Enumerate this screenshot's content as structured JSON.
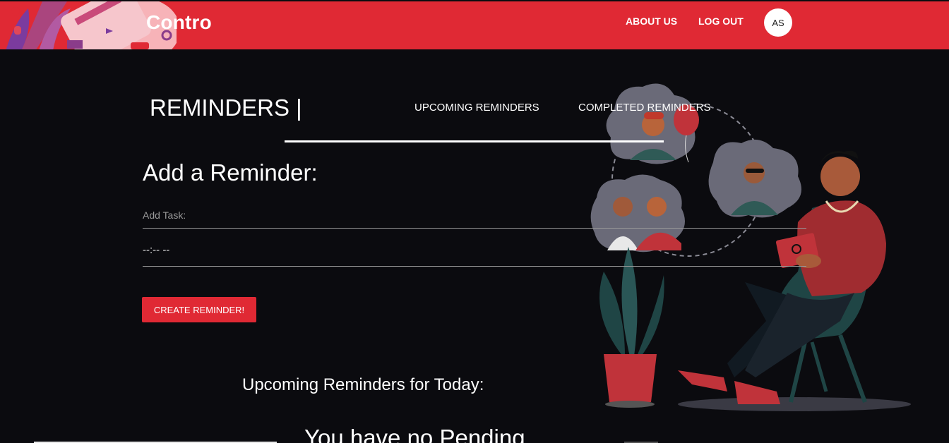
{
  "navbar": {
    "brand": "Contro",
    "links": [
      {
        "label": "ABOUT US"
      },
      {
        "label": "LOG OUT"
      }
    ],
    "avatar_initials": "AS",
    "accent_color": "#e02934"
  },
  "header": {
    "title": "REMINDERS |",
    "tabs": [
      {
        "label": "UPCOMING REMINDERS"
      },
      {
        "label": "COMPLETED REMINDERS"
      }
    ]
  },
  "form": {
    "heading": "Add a Reminder:",
    "task_placeholder": "Add Task:",
    "task_value": "",
    "time_value": "--:-- --",
    "submit_label": "CREATE REMINDER!"
  },
  "upcoming": {
    "title": "Upcoming Reminders for Today:",
    "empty_message": "You have no Pending"
  }
}
